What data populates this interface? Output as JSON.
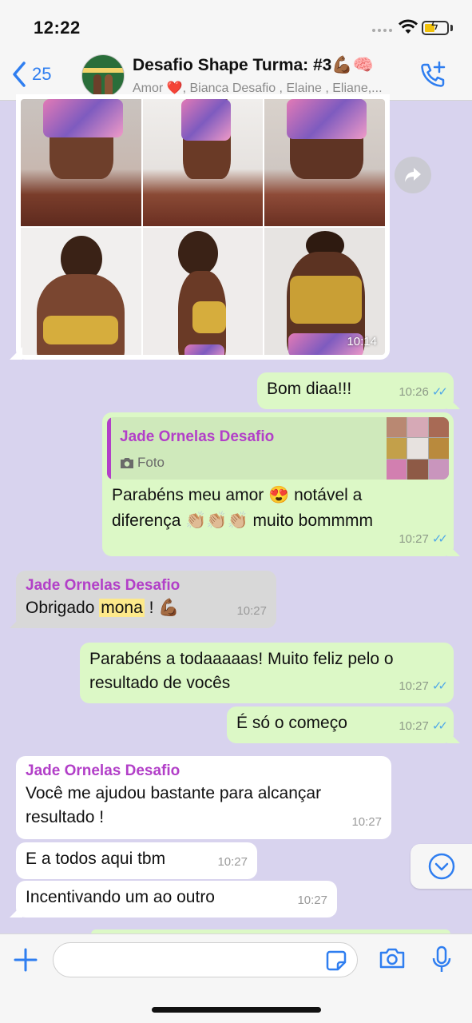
{
  "status_bar": {
    "time": "12:22"
  },
  "header": {
    "back_count": "25",
    "title": "Desafio Shape Turma: #3💪🏾🧠",
    "subtitle": "Amor ❤️, Bianca Desafio , Elaine , Eliane,...",
    "avatar_label": "DESAFIO SHAPE"
  },
  "messages": {
    "photo": {
      "time": "10:14"
    },
    "m1": {
      "text": "Bom diaa!!!",
      "time": "10:26"
    },
    "m2": {
      "quote_name": "Jade Ornelas Desafio",
      "quote_type": "Foto",
      "text_1": "Parabéns meu amor 😍 notável a",
      "text_2": "diferença 👏🏼👏🏼👏🏼 muito bommmm",
      "time": "10:27"
    },
    "m3": {
      "sender": "Jade Ornelas Desafio",
      "text_before": "Obrigado ",
      "text_highlight": "mona",
      "text_after": " ! 💪🏾",
      "time": "10:27"
    },
    "m4": {
      "text": "Parabéns a todaaaaas! Muito feliz pelo o resultado de vocês",
      "time": "10:27"
    },
    "m5": {
      "text": "É só o começo",
      "time": "10:27"
    },
    "m6": {
      "sender": "Jade Ornelas Desafio",
      "text": "Você me ajudou bastante para alcançar resultado !",
      "time": "10:27"
    },
    "m7": {
      "text": "E a todos aqui tbm",
      "time": "10:27"
    },
    "m8": {
      "text": "Incentivando um ao outro",
      "time": "10:27"
    }
  },
  "input": {
    "placeholder": ""
  },
  "colors": {
    "chat_background": "#d8d3ee",
    "outgoing_bubble": "#dcf8c6",
    "incoming_bubble": "#ffffff",
    "sender_name": "#b23fc8",
    "accent_blue": "#2f7ef0",
    "read_ticks": "#4fa8e8"
  },
  "icons": [
    "back-chevron-icon",
    "add-call-icon",
    "forward-icon",
    "camera-icon",
    "double-check-icon",
    "chevron-down-icon",
    "plus-icon",
    "sticker-icon",
    "microphone-icon",
    "wifi-icon",
    "battery-icon"
  ]
}
